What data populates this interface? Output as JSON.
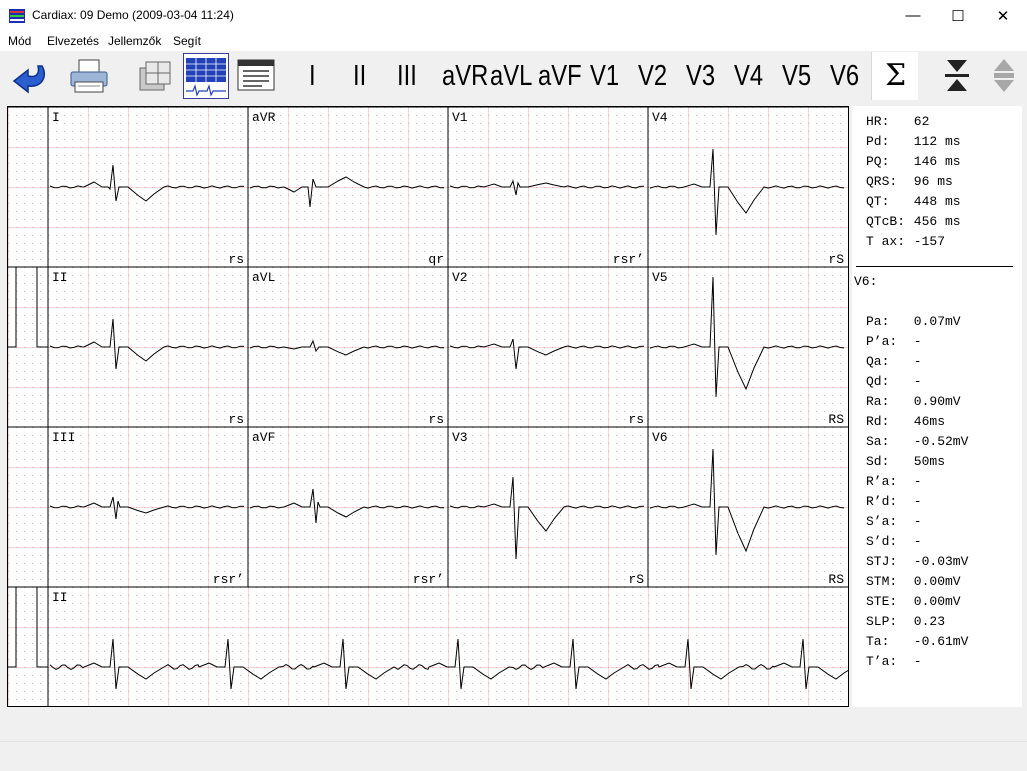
{
  "window": {
    "title": "Cardiax: 09 Demo (2009-03-04 11:24)",
    "controls": {
      "minimize": "—",
      "maximize": "☐",
      "close": "✕"
    }
  },
  "menu": [
    "Mód",
    "Elvezetés",
    "Jellemzők",
    "Segít"
  ],
  "toolbar": {
    "icons": [
      "back-arrow-icon",
      "printer-icon",
      "layout-icon",
      "twelve-lead-grid-icon",
      "report-icon"
    ],
    "leads": [
      "I",
      "II",
      "III",
      "aVR",
      "aVL",
      "aVF",
      "V1",
      "V2",
      "V3",
      "V4",
      "V5",
      "V6"
    ],
    "sigma": "Σ",
    "right_icons": [
      "compress-vertical-icon",
      "scroll-vertical-icon"
    ]
  },
  "ecg": {
    "grid_colors": {
      "major": "#e8a3a3",
      "minor_dots": "#c9a0a0",
      "trace": "#000000",
      "separator": "#000000"
    },
    "panels": [
      {
        "lead": "I",
        "morphology": "rs"
      },
      {
        "lead": "aVR",
        "morphology": "qr"
      },
      {
        "lead": "V1",
        "morphology": "rsr’"
      },
      {
        "lead": "V4",
        "morphology": "rS"
      },
      {
        "lead": "II",
        "morphology": "rs"
      },
      {
        "lead": "aVL",
        "morphology": "rs"
      },
      {
        "lead": "V2",
        "morphology": "rs"
      },
      {
        "lead": "V5",
        "morphology": "RS"
      },
      {
        "lead": "III",
        "morphology": "rsr’"
      },
      {
        "lead": "aVF",
        "morphology": "rsr’"
      },
      {
        "lead": "V3",
        "morphology": "rS"
      },
      {
        "lead": "V6",
        "morphology": "RS"
      }
    ],
    "rhythm_lead": "II"
  },
  "measurements": {
    "global": [
      {
        "label": "HR:",
        "value": "62"
      },
      {
        "label": "Pd:",
        "value": "112 ms"
      },
      {
        "label": "PQ:",
        "value": "146 ms"
      },
      {
        "label": "QRS:",
        "value": "96 ms"
      },
      {
        "label": "QT:",
        "value": "448 ms"
      },
      {
        "label": "QTcB:",
        "value": "456 ms"
      },
      {
        "label": "T ax:",
        "value": "-157"
      }
    ],
    "lead_title": "V6:",
    "lead": [
      {
        "label": "Pa:",
        "value": "0.07mV"
      },
      {
        "label": "P’a:",
        "value": "-"
      },
      {
        "label": "Qa:",
        "value": "-"
      },
      {
        "label": "Qd:",
        "value": "-"
      },
      {
        "label": "Ra:",
        "value": "0.90mV"
      },
      {
        "label": "Rd:",
        "value": "46ms"
      },
      {
        "label": "Sa:",
        "value": "-0.52mV"
      },
      {
        "label": "Sd:",
        "value": "50ms"
      },
      {
        "label": "R’a:",
        "value": "-"
      },
      {
        "label": "R’d:",
        "value": "-"
      },
      {
        "label": "S’a:",
        "value": "-"
      },
      {
        "label": "S’d:",
        "value": "-"
      },
      {
        "label": "STJ:",
        "value": "-0.03mV"
      },
      {
        "label": "STM:",
        "value": "0.00mV"
      },
      {
        "label": "STE:",
        "value": "0.00mV"
      },
      {
        "label": "SLP:",
        "value": "0.23"
      },
      {
        "label": "Ta:",
        "value": "-0.61mV"
      },
      {
        "label": "T’a:",
        "value": "-"
      }
    ]
  }
}
